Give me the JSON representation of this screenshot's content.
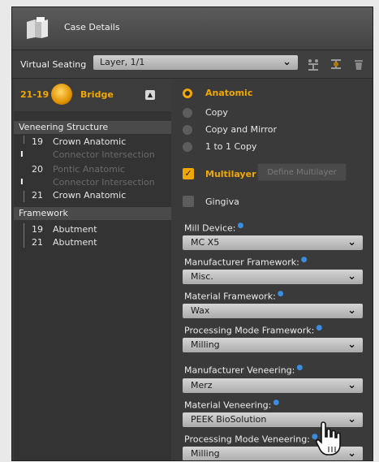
{
  "window": {
    "title": "Case Details"
  },
  "seating": {
    "label": "Virtual Seating",
    "value": "Layer, 1/1",
    "tools": [
      "seat-add-icon",
      "seat-move-icon",
      "trash-icon"
    ]
  },
  "tree": {
    "range": "21-19",
    "type": "Bridge",
    "collapse_glyph": "▲",
    "veneering": {
      "heading": "Veneering Structure",
      "items": [
        {
          "num": "19",
          "label": "Crown Anatomic"
        },
        {
          "num": "",
          "label": "Connector Intersection"
        },
        {
          "num": "20",
          "label": "Pontic Anatomic"
        },
        {
          "num": "",
          "label": "Connector Intersection"
        },
        {
          "num": "21",
          "label": "Crown Anatomic"
        }
      ]
    },
    "framework": {
      "heading": "Framework",
      "items": [
        {
          "num": "19",
          "label": "Abutment"
        },
        {
          "num": "21",
          "label": "Abutment"
        }
      ]
    }
  },
  "options": {
    "radios": [
      "Anatomic",
      "Copy",
      "Copy and Mirror",
      "1 to 1 Copy"
    ],
    "selected_radio": "Anatomic",
    "multilayer": "Multilayer",
    "define_multilayer": "Define Multilayer",
    "gingiva": "Gingiva"
  },
  "fields": [
    {
      "label": "Mill Device:",
      "value": "MC X5"
    },
    {
      "label": "Manufacturer Framework:",
      "value": "Misc."
    },
    {
      "label": "Material Framework:",
      "value": "Wax"
    },
    {
      "label": "Processing Mode Framework:",
      "value": "Milling"
    },
    {
      "label": "Manufacturer Veneering:",
      "value": "Merz"
    },
    {
      "label": "Material Veneering:",
      "value": "PEEK BioSolution"
    },
    {
      "label": "Processing Mode Veneering:",
      "value": "Milling"
    }
  ],
  "colors": {
    "accent": "#f0a800",
    "info": "#3a8de0",
    "panel": "#3a3a3a"
  }
}
